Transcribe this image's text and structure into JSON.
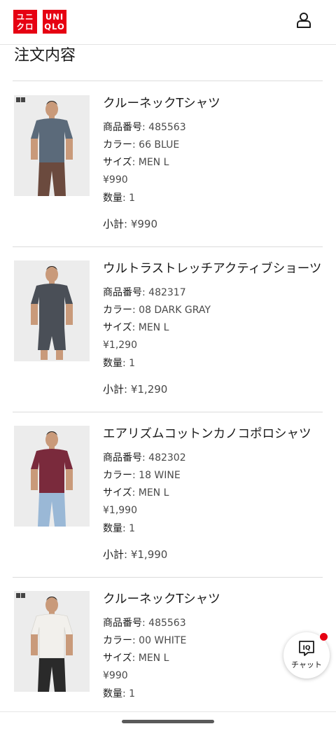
{
  "brand": {
    "logo_line1": "ユニ",
    "logo_line2": "クロ",
    "logo_line3": "UNI",
    "logo_line4": "QLO",
    "color": "#e60012"
  },
  "header": {
    "account_icon": "account-icon"
  },
  "page": {
    "title": "注文内容"
  },
  "labels": {
    "product_no": "商品番号",
    "color": "カラー",
    "size": "サイズ",
    "quantity": "数量",
    "subtotal": "小計"
  },
  "items": [
    {
      "name": "クルーネックTシャツ",
      "product_no": ": 485563",
      "color": ": 66 BLUE",
      "size": ": MEN L",
      "price": "¥990",
      "quantity": ": 1",
      "subtotal": ": ¥990",
      "garment_color": "#5b6a7a"
    },
    {
      "name": "ウルトラストレッチアクティブショーツ",
      "product_no": ": 482317",
      "color": ": 08 DARK GRAY",
      "size": ": MEN L",
      "price": "¥1,290",
      "quantity": ": 1",
      "subtotal": ": ¥1,290",
      "garment_color": "#4a4f57"
    },
    {
      "name": "エアリズムコットンカノコポロシャツ",
      "product_no": ": 482302",
      "color": ": 18 WINE",
      "size": ": MEN L",
      "price": "¥1,990",
      "quantity": ": 1",
      "subtotal": ": ¥1,990",
      "garment_color": "#7a2a3c"
    },
    {
      "name": "クルーネックTシャツ",
      "product_no": ": 485563",
      "color": ": 00 WHITE",
      "size": ": MEN L",
      "price": "¥990",
      "quantity": ": 1",
      "subtotal": "",
      "garment_color": "#f2f0ec"
    }
  ],
  "chat": {
    "label": "チャット",
    "icon_text": "IQ"
  }
}
